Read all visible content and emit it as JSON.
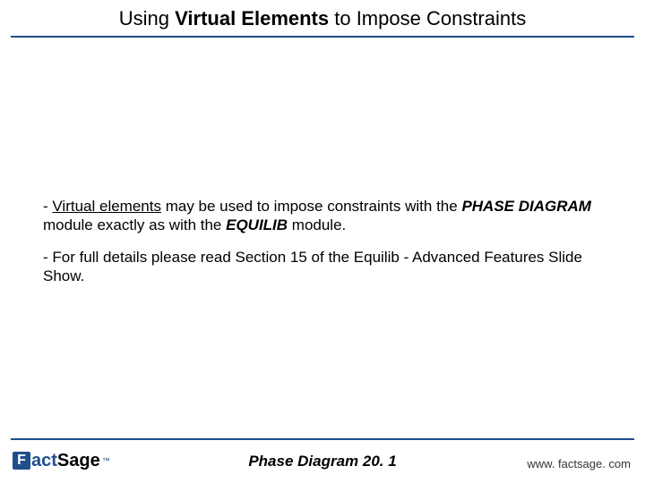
{
  "title": {
    "prefix": "Using ",
    "virtual": "Virtual Elements",
    "suffix": " to Impose Constraints"
  },
  "body": {
    "p1": {
      "dash": "- ",
      "virtual_elements": "Virtual elements",
      "mid1": " may be used to impose constraints with the ",
      "phase_diagram": "PHASE DIAGRAM",
      "mid2": " module exactly as with the ",
      "equilib": "EQUILIB",
      "tail": " module."
    },
    "p2": "- For full details please read Section 15 of the Equilib - Advanced Features Slide Show."
  },
  "logo": {
    "f": "F",
    "act": "act",
    "sage": "Sage",
    "tm": "™"
  },
  "footer": {
    "center": "Phase Diagram  20. 1",
    "right": "www. factsage. com"
  }
}
